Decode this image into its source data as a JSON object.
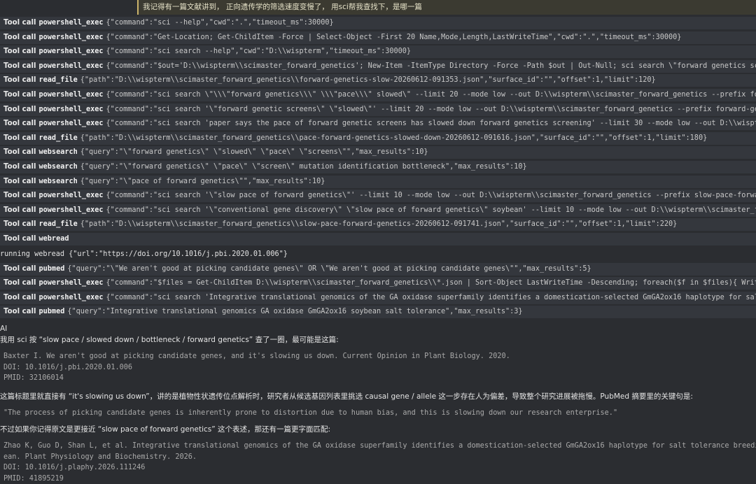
{
  "prompt": "我记得有一篇文献讲到，  正向遗传学的筛选速度变慢了，  用sci帮我查找下，是哪一篇",
  "tool_call_label": "Tool call",
  "tools_a": [
    {
      "name": "powershell_exec",
      "args": "{\"command\":\"sci --help\",\"cwd\":\".\",\"timeout_ms\":30000}"
    },
    {
      "name": "powershell_exec",
      "args": "{\"command\":\"Get-Location; Get-ChildItem -Force | Select-Object -First 20 Name,Mode,Length,LastWriteTime\",\"cwd\":\".\",\"timeout_ms\":30000}"
    },
    {
      "name": "powershell_exec",
      "args": "{\"command\":\"sci search --help\",\"cwd\":\"D:\\\\wispterm\",\"timeout_ms\":30000}"
    },
    {
      "name": "powershell_exec",
      "args": "{\"command\":\"$out='D:\\\\wispterm\\\\scimaster_forward_genetics'; New-Item -ItemType Directory -Force -Path $out | Out-Null; sci search \\\"forward genetics screen"
    },
    {
      "name": "read_file",
      "args": "{\"path\":\"D:\\\\wispterm\\\\scimaster_forward_genetics\\\\forward-genetics-slow-20260612-091353.json\",\"surface_id\":\"\",\"offset\":1,\"limit\":120}"
    },
    {
      "name": "powershell_exec",
      "args": "{\"command\":\"sci search \\\"\\\\\\\"forward genetics\\\\\\\" \\\\\\\"pace\\\\\\\" slowed\\\" --limit 20 --mode low --out D:\\\\wispterm\\\\scimaster_forward_genetics --prefix forwar"
    },
    {
      "name": "powershell_exec",
      "args": "{\"command\":\"sci search '\\\"forward genetic screens\\\" \\\"slowed\\\"' --limit 20 --mode low --out D:\\\\wispterm\\\\scimaster_forward_genetics --prefix forward-geneti"
    },
    {
      "name": "powershell_exec",
      "args": "{\"command\":\"sci search 'paper says the pace of forward genetic screens has slowed down forward genetics screening' --limit 30 --mode low --out D:\\\\wispterm\\"
    },
    {
      "name": "read_file",
      "args": "{\"path\":\"D:\\\\wispterm\\\\scimaster_forward_genetics\\\\pace-forward-genetics-slowed-down-20260612-091616.json\",\"surface_id\":\"\",\"offset\":1,\"limit\":180}"
    },
    {
      "name": "websearch",
      "args": "{\"query\":\"\\\"forward genetics\\\" \\\"slowed\\\" \\\"pace\\\" \\\"screens\\\"\",\"max_results\":10}"
    },
    {
      "name": "websearch",
      "args": "{\"query\":\"\\\"forward genetics\\\" \\\"pace\\\" \\\"screen\\\" mutation identification bottleneck\",\"max_results\":10}"
    },
    {
      "name": "websearch",
      "args": "{\"query\":\"\\\"pace of forward genetics\\\"\",\"max_results\":10}"
    },
    {
      "name": "powershell_exec",
      "args": "{\"command\":\"sci search '\\\"slow pace of forward genetics\\\"' --limit 10 --mode low --out D:\\\\wispterm\\\\scimaster_forward_genetics --prefix slow-pace-forward-g"
    },
    {
      "name": "powershell_exec",
      "args": "{\"command\":\"sci search '\\\"conventional gene discovery\\\" \\\"slow pace of forward genetics\\\" soybean' --limit 10 --mode low --out D:\\\\wispterm\\\\scimaster_forwa"
    },
    {
      "name": "read_file",
      "args": "{\"path\":\"D:\\\\wispterm\\\\scimaster_forward_genetics\\\\slow-pace-forward-genetics-20260612-091741.json\",\"surface_id\":\"\",\"offset\":1,\"limit\":220}"
    },
    {
      "name": "webread",
      "args": ""
    }
  ],
  "running": "running webread {\"url\":\"https://doi.org/10.1016/j.pbi.2020.01.006\"}",
  "tools_b": [
    {
      "name": "pubmed",
      "args": "{\"query\":\"\\\"We aren't good at picking candidate genes\\\" OR \\\"We aren't good at picking candidate genes\\\"\",\"max_results\":5}"
    },
    {
      "name": "powershell_exec",
      "args": "{\"command\":\"$files = Get-ChildItem D:\\\\wispterm\\\\scimaster_forward_genetics\\\\*.json | Sort-Object LastWriteTime -Descending; foreach($f in $files){ Write-Ho"
    },
    {
      "name": "powershell_exec",
      "args": "{\"command\":\"sci search 'Integrative translational genomics of the GA oxidase superfamily identifies a domestication-selected GmGA2ox16 haplotype for salt to"
    },
    {
      "name": "pubmed",
      "args": "{\"query\":\"Integrative translational genomics GA oxidase GmGA2ox16 soybean salt tolerance\",\"max_results\":3}"
    }
  ],
  "ai": {
    "label": "AI",
    "p1": "我用 sci 按 “slow pace / slowed down / bottleneck / forward genetics” 查了一圈，最可能是这篇:",
    "ref1": [
      "Baxter I. We aren't good at picking candidate genes, and it's slowing us down. Current Opinion in Plant Biology. 2020.",
      "DOI: 10.1016/j.pbi.2020.01.006",
      "PMID: 32106014"
    ],
    "p2": "这篇标题里就直接有 “it's slowing us down”，讲的是植物性状遗传位点解析时，研究者从候选基因列表里挑选 causal gene / allele 这一步存在人为偏差，导致整个研究进展被拖慢。PubMed 摘要里的关键句是:",
    "quote": "\"The process of picking candidate genes is inherently prone to distortion due to human bias, and this is slowing down our research enterprise.\"",
    "p3": "不过如果你记得原文是更接近 “slow pace of forward genetics” 这个表述，那还有一篇更字面匹配:",
    "ref2": [
      "Zhao K, Guo D, Shan L, et al. Integrative translational genomics of the GA oxidase superfamily identifies a domestication-selected GmGA2ox16 haplotype for salt tolerance breeding in",
      "ean. Plant Physiology and Biochemistry. 2026.",
      "DOI: 10.1016/j.plaphy.2026.111246",
      "PMID: 41895219"
    ]
  }
}
